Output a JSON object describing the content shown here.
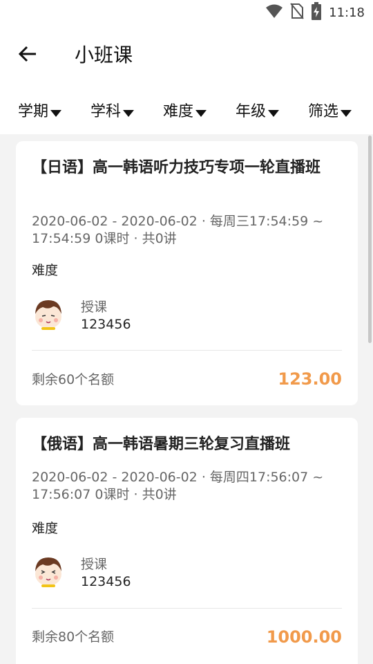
{
  "status_bar": {
    "time": "11:18",
    "icons": [
      "wifi-icon",
      "no-sim-icon",
      "battery-charging-icon"
    ]
  },
  "header": {
    "title": "小班课",
    "back_icon": "arrow-left-icon"
  },
  "filters": [
    {
      "label": "学期"
    },
    {
      "label": "学科"
    },
    {
      "label": "难度"
    },
    {
      "label": "年级"
    },
    {
      "label": "筛选"
    }
  ],
  "courses": [
    {
      "title": "【日语】高一韩语听力技巧专项一轮直播班",
      "schedule": "2020-06-02 - 2020-06-02 · 每周三17:54:59 ~ 17:54:59    0课时 · 共0讲",
      "difficulty_label": "难度",
      "teacher_role": "授课",
      "teacher_name": "123456",
      "remaining": "剩余60个名额",
      "price": "123.00"
    },
    {
      "title": "【俄语】高一韩语暑期三轮复习直播班",
      "schedule": "2020-06-02 - 2020-06-02 · 每周四17:56:07 ~ 17:56:07    0课时 · 共0讲",
      "difficulty_label": "难度",
      "teacher_role": "授课",
      "teacher_name": "123456",
      "remaining": "剩余80个名额",
      "price": "1000.00"
    }
  ],
  "colors": {
    "accent_price": "#f19a4b",
    "background": "#f3f3f3"
  }
}
